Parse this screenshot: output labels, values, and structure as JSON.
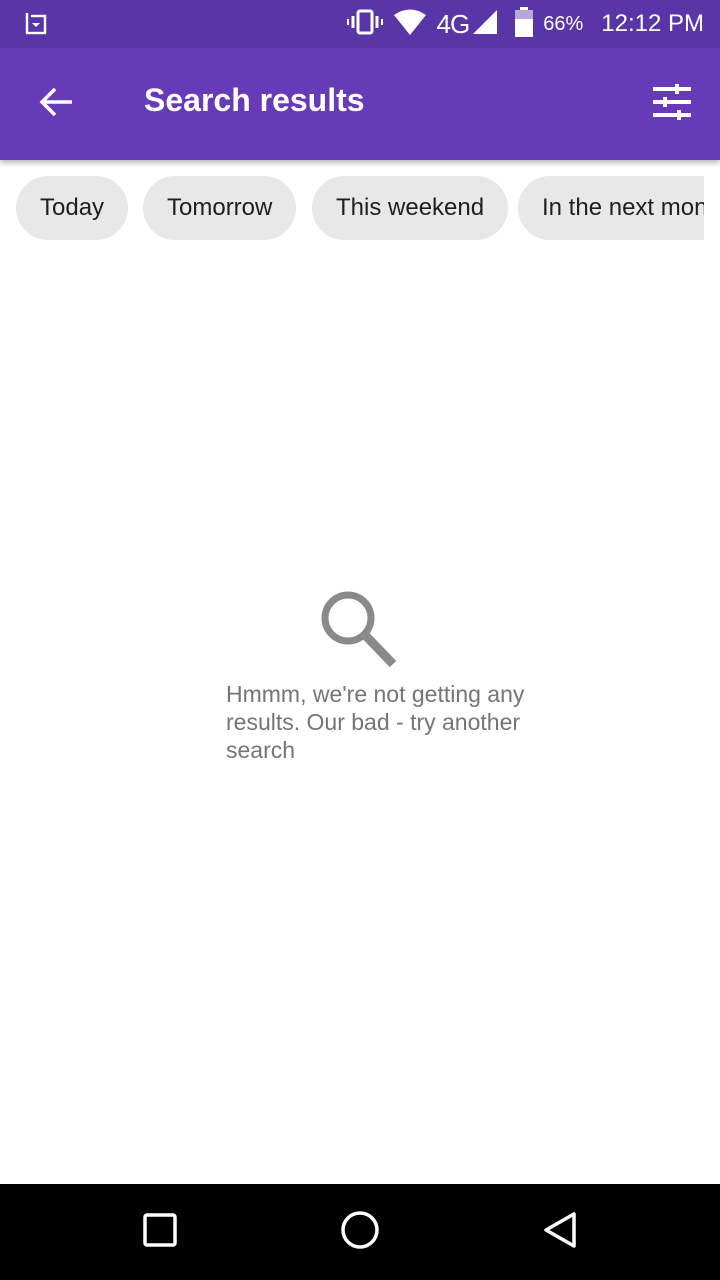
{
  "status_bar": {
    "network": "4G",
    "battery": "66%",
    "time": "12:12 PM",
    "icons": [
      "screenshot-icon",
      "vibrate-icon",
      "wifi-icon",
      "signal-icon",
      "battery-icon"
    ]
  },
  "app_bar": {
    "title": "Search results",
    "back_icon": "arrow-left-icon",
    "filter_icon": "tune-icon"
  },
  "chips": [
    {
      "label": "Today"
    },
    {
      "label": "Tomorrow"
    },
    {
      "label": "This weekend"
    },
    {
      "label": "In the next month"
    }
  ],
  "empty_state": {
    "icon": "search-icon",
    "message": "Hmmm, we're not getting any results. Our bad - try another search"
  },
  "nav_bar": {
    "icons": [
      "recents-icon",
      "home-icon",
      "back-icon"
    ]
  },
  "colors": {
    "status_bar": "#5a35a8",
    "app_bar": "#673ab7",
    "chip_bg": "#e8e8e8",
    "empty_text": "#757575",
    "empty_icon": "#8a8a8a"
  }
}
